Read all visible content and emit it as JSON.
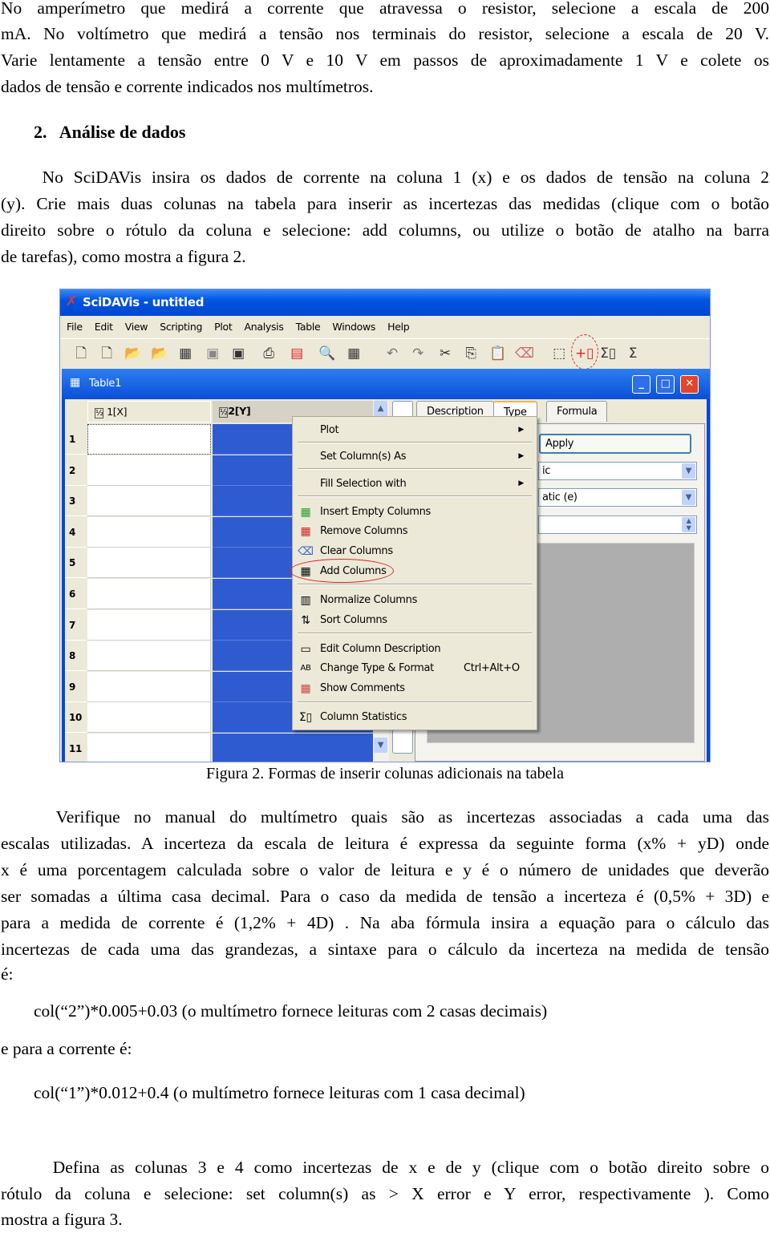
{
  "para1": [
    "No amperímetro que medirá a corrente que atravessa o resistor, selecione a escala de 200",
    "mA. No voltímetro que medirá a tensão nos terminais do resistor, selecione a escala de 20 V.",
    "Varie lentamente a tensão entre 0 V e 10 V em passos de aproximadamente 1 V e colete os",
    "dados de tensão e corrente indicados nos multímetros."
  ],
  "heading": "2.   Análise de dados",
  "para2": [
    "    No SciDAVis insira os dados de corrente na coluna 1 (x) e os dados de tensão na coluna 2",
    "(y). Crie mais duas colunas na tabela para inserir as incertezas das medidas (clique com o botão",
    "direito sobre o rótulo da coluna e selecione: add columns, ou utilize o botão de atalho na barra",
    "de tarefas), como mostra a figura 2."
  ],
  "figure": {
    "app_title": "SciDAVis - untitled",
    "menu": [
      "File",
      "Edit",
      "View",
      "Scripting",
      "Plot",
      "Analysis",
      "Table",
      "Windows",
      "Help"
    ],
    "window_title": "Table1",
    "columns": [
      "1[X]",
      "2[Y]"
    ],
    "rows": [
      "1",
      "2",
      "3",
      "4",
      "5",
      "6",
      "7",
      "8",
      "9",
      "10",
      "11"
    ],
    "tabs": [
      "Description",
      "Type",
      "Formula"
    ],
    "apply": "Apply",
    "combo1": "ic",
    "combo2": "atic (e)",
    "context_menu": {
      "plot": "Plot",
      "set_as": "Set Column(s) As",
      "fill": "Fill Selection with",
      "insert": "Insert Empty Columns",
      "remove": "Remove Columns",
      "clear": "Clear Columns",
      "add": "Add Columns",
      "normalize": "Normalize Columns",
      "sort": "Sort Columns",
      "edit_desc": "Edit Column Description",
      "change_type": "Change Type & Format",
      "change_type_shortcut": "Ctrl+Alt+O",
      "comments": "Show Comments",
      "stats": "Column Statistics"
    },
    "highlight_color": "#d9262b"
  },
  "caption": "Figura 2. Formas de inserir colunas adicionais na tabela",
  "para3": [
    "    Verifique no manual do multímetro quais são as incertezas associadas a cada uma das",
    "escalas utilizadas. A incerteza da escala de leitura é expressa da seguinte forma (x% + yD) onde",
    "x é uma porcentagem calculada sobre o valor de leitura e y é o número de unidades que deverão",
    "ser somadas a última casa decimal. Para o caso da medida de tensão a incerteza é (0,5% + 3D) e",
    "para a medida de corrente é (1,2% + 4D) . Na aba fórmula insira a equação para o cálculo das",
    "incertezas de cada uma das grandezas, a sintaxe para o cálculo da incerteza na medida de tensão",
    "é:"
  ],
  "formula1": "col(“2”)*0.005+0.03 (o multímetro fornece leituras com 2 casas decimais)",
  "para_current": "e para a corrente é:",
  "formula2": "col(“1”)*0.012+0.4 (o multímetro fornece leituras com 1 casa decimal)",
  "para4": [
    "     Defina as colunas 3 e 4 como incertezas de x e de y (clique com o botão direito sobre o",
    "rótulo da coluna e selecione: set column(s) as > X error e Y error, respectivamente ). Como",
    "mostra a figura 3."
  ]
}
